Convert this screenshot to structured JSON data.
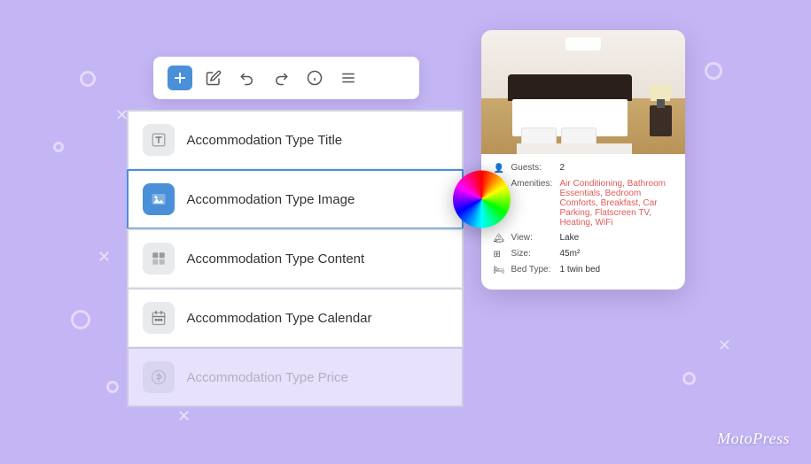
{
  "background": {
    "color": "#c4b5f5"
  },
  "toolbar": {
    "buttons": [
      {
        "label": "+",
        "icon": "plus-icon",
        "primary": true
      },
      {
        "label": "✏",
        "icon": "edit-icon",
        "primary": false
      },
      {
        "label": "↩",
        "icon": "undo-icon",
        "primary": false
      },
      {
        "label": "↪",
        "icon": "redo-icon",
        "primary": false
      },
      {
        "label": "ℹ",
        "icon": "info-icon",
        "primary": false
      },
      {
        "label": "≡",
        "icon": "menu-icon",
        "primary": false
      }
    ]
  },
  "blocks": [
    {
      "label": "Accommodation Type Title",
      "icon": "title-icon",
      "active": false,
      "disabled": false
    },
    {
      "label": "Accommodation Type Image",
      "icon": "image-icon",
      "active": true,
      "disabled": false
    },
    {
      "label": "Accommodation Type Content",
      "icon": "content-icon",
      "active": false,
      "disabled": false
    },
    {
      "label": "Accommodation Type Calendar",
      "icon": "calendar-icon",
      "active": false,
      "disabled": false
    },
    {
      "label": "Accommodation Type Price",
      "icon": "price-icon",
      "active": false,
      "disabled": true
    }
  ],
  "property_card": {
    "details": [
      {
        "icon": "guests-icon",
        "label": "Guests:",
        "value": "2",
        "links": false
      },
      {
        "icon": "amenities-icon",
        "label": "Amenities:",
        "value": "Air Conditioning, Bathroom Essentials, Bedroom Comforts, Breakfast, Car Parking, Flatscreen TV, Heating, WiFi",
        "links": true
      },
      {
        "icon": "view-icon",
        "label": "View:",
        "value": "Lake",
        "links": false
      },
      {
        "icon": "size-icon",
        "label": "Size:",
        "value": "45m²",
        "links": false
      },
      {
        "icon": "bed-icon",
        "label": "Bed Type:",
        "value": "1 twin bed",
        "links": false
      }
    ]
  },
  "branding": {
    "logo_text": "MotoPress"
  }
}
